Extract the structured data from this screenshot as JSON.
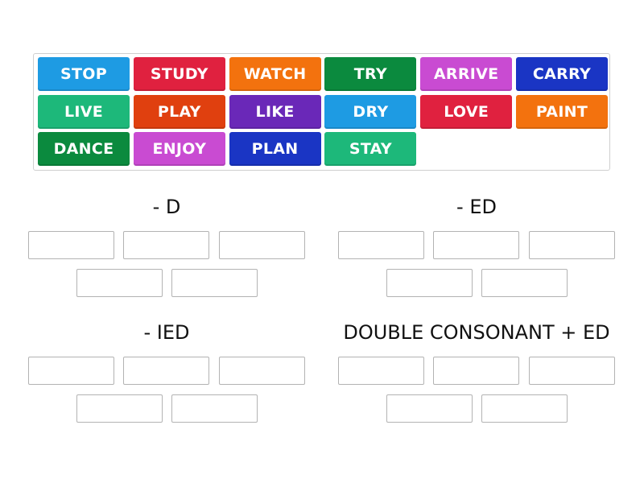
{
  "tiles": [
    {
      "label": "STOP",
      "color": "#1e9be3"
    },
    {
      "label": "STUDY",
      "color": "#e0213f"
    },
    {
      "label": "WATCH",
      "color": "#f3720e"
    },
    {
      "label": "TRY",
      "color": "#0b8a3e"
    },
    {
      "label": "ARRIVE",
      "color": "#c94bd2"
    },
    {
      "label": "CARRY",
      "color": "#1a35c4"
    },
    {
      "label": "LIVE",
      "color": "#1db87a"
    },
    {
      "label": "PLAY",
      "color": "#e0400f"
    },
    {
      "label": "LIKE",
      "color": "#6a28b8"
    },
    {
      "label": "DRY",
      "color": "#1e9be3"
    },
    {
      "label": "LOVE",
      "color": "#e0213f"
    },
    {
      "label": "PAINT",
      "color": "#f3720e"
    },
    {
      "label": "DANCE",
      "color": "#0b8a3e"
    },
    {
      "label": "ENJOY",
      "color": "#c94bd2"
    },
    {
      "label": "PLAN",
      "color": "#1a35c4"
    },
    {
      "label": "STAY",
      "color": "#1db87a"
    }
  ],
  "groups": [
    {
      "title": "- D",
      "slots": 5
    },
    {
      "title": "- ED",
      "slots": 5
    },
    {
      "title": "- IED",
      "slots": 5
    },
    {
      "title": "DOUBLE CONSONANT + ED",
      "slots": 5
    }
  ]
}
